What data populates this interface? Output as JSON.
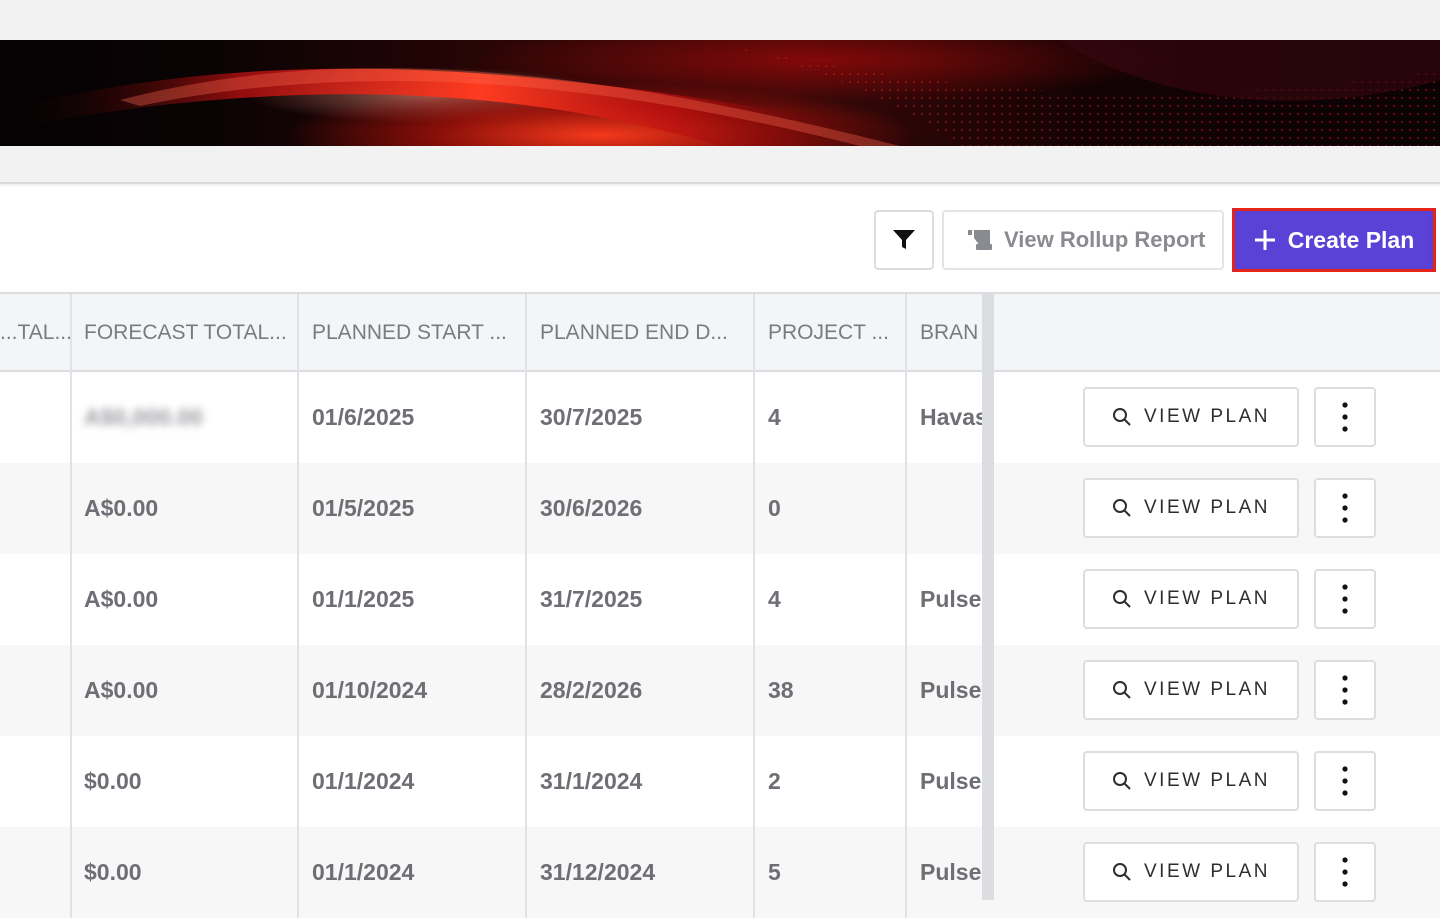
{
  "toolbar": {
    "rollup_label": "View Rollup Report",
    "create_label": "Create Plan",
    "accent_color": "#5a3fd4",
    "highlight_color": "#e3251c"
  },
  "table": {
    "columns": [
      "...TAL...",
      "FORECAST TOTAL...",
      "PLANNED START ...",
      "PLANNED END D...",
      "PROJECT ...",
      "BRAN"
    ],
    "view_label": "VIEW PLAN",
    "rows": [
      {
        "prev": "",
        "forecast": "A$0,000.00",
        "start": "01/6/2025",
        "end": "30/7/2025",
        "project": "4",
        "brand": "Havas",
        "blurred": true
      },
      {
        "prev": "",
        "forecast": "A$0.00",
        "start": "01/5/2025",
        "end": "30/6/2026",
        "project": "0",
        "brand": "",
        "blurred": false
      },
      {
        "prev": "",
        "forecast": "A$0.00",
        "start": "01/1/2025",
        "end": "31/7/2025",
        "project": "4",
        "brand": "Pulse",
        "blurred": false
      },
      {
        "prev": "",
        "forecast": "A$0.00",
        "start": "01/10/2024",
        "end": "28/2/2026",
        "project": "38",
        "brand": "Pulse",
        "blurred": false
      },
      {
        "prev": "",
        "forecast": "$0.00",
        "start": "01/1/2024",
        "end": "31/1/2024",
        "project": "2",
        "brand": "Pulse",
        "blurred": false
      },
      {
        "prev": "",
        "forecast": "$0.00",
        "start": "01/1/2024",
        "end": "31/12/2024",
        "project": "5",
        "brand": "Pulse",
        "blurred": false
      }
    ]
  },
  "icons": {
    "filter": "filter-icon",
    "rollup": "report-icon",
    "create": "plus-icon",
    "view": "search-icon",
    "more": "kebab-menu-icon"
  }
}
